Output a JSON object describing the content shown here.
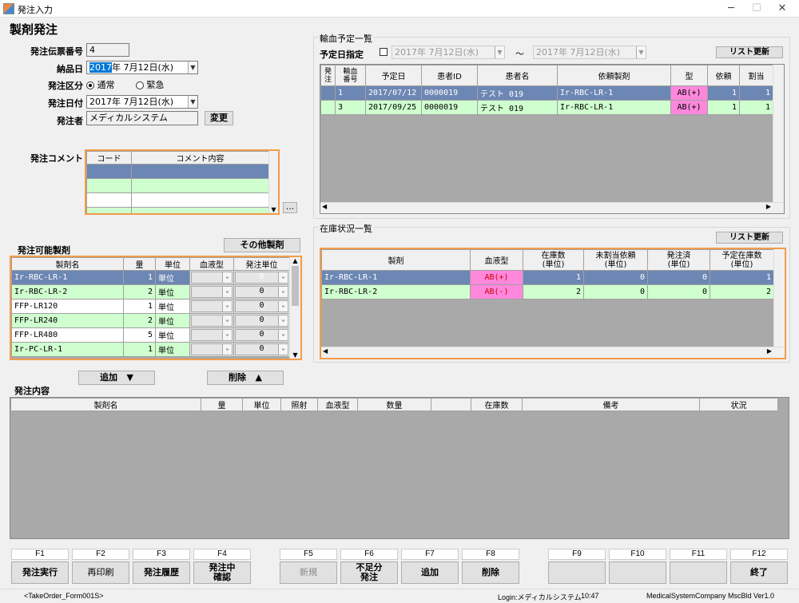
{
  "window": {
    "title": "発注入力"
  },
  "header": {
    "title": "製剤発注"
  },
  "form": {
    "slip_label": "発注伝票番号",
    "slip_value": "4",
    "delivery_label": "納品日",
    "delivery_year": "2017",
    "delivery_rest": "年  7月12日(水)",
    "kubun_label": "発注区分",
    "normal": "通常",
    "urgent": "緊急",
    "order_date_label": "発注日付",
    "order_date": "2017年  7月12日(水)",
    "orderer_label": "発注者",
    "orderer_value": "メディカルシステム",
    "change_btn": "変更",
    "comment_label": "発注コメント",
    "comment_col1": "コード",
    "comment_col2": "コメント内容",
    "more_btn": "..."
  },
  "transfusion": {
    "title": "輸血予定一覧",
    "date_label": "予定日指定",
    "date_from": "2017年  7月12日(水)",
    "tilde": "～",
    "date_to": "2017年  7月12日(水)",
    "refresh": "リスト更新",
    "columns": [
      "発注",
      "輸血番号",
      "予定日",
      "患者ID",
      "患者名",
      "依頼製剤",
      "型",
      "依頼",
      "割当"
    ],
    "col_order": "発注",
    "col_no_1": "輸血",
    "col_no_2": "番号",
    "rows": [
      {
        "no": "1",
        "date": "2017/07/12",
        "pid": "0000019",
        "name": "テスト  019",
        "product": "Ir-RBC-LR-1",
        "type": "AB(+)",
        "req": "1",
        "alloc": "1"
      },
      {
        "no": "3",
        "date": "2017/09/25",
        "pid": "0000019",
        "name": "テスト  019",
        "product": "Ir-RBC-LR-1",
        "type": "AB(+)",
        "req": "1",
        "alloc": "1"
      }
    ]
  },
  "available": {
    "title": "発注可能製剤",
    "other_btn": "その他製剤",
    "columns": [
      "製剤名",
      "量",
      "単位",
      "血液型",
      "発注単位"
    ],
    "rows": [
      {
        "name": "Ir-RBC-LR-1",
        "qty": "1",
        "unit": "単位",
        "sel": "0"
      },
      {
        "name": "Ir-RBC-LR-2",
        "qty": "2",
        "unit": "単位",
        "sel": "0"
      },
      {
        "name": "FFP-LR120",
        "qty": "1",
        "unit": "単位",
        "sel": "0"
      },
      {
        "name": "FFP-LR240",
        "qty": "2",
        "unit": "単位",
        "sel": "0"
      },
      {
        "name": "FFP-LR480",
        "qty": "5",
        "unit": "単位",
        "sel": "0"
      },
      {
        "name": "Ir-PC-LR-1",
        "qty": "1",
        "unit": "単位",
        "sel": "0"
      }
    ]
  },
  "stock": {
    "title": "在庫状況一覧",
    "refresh": "リスト更新",
    "col_product": "製剤",
    "col_blood": "血液型",
    "col_stock_1": "在庫数",
    "col_stock_2": "(単位)",
    "col_unalloc_1": "未割当依頼",
    "col_unalloc_2": "(単位)",
    "col_ordered_1": "発注済",
    "col_ordered_2": "(単位)",
    "col_planned_1": "予定在庫数",
    "col_planned_2": "(単位)",
    "rows": [
      {
        "product": "Ir-RBC-LR-1",
        "blood": "AB(+)",
        "stock": "1",
        "unalloc": "0",
        "ordered": "0",
        "planned": "1"
      },
      {
        "product": "Ir-RBC-LR-2",
        "blood": "AB(-)",
        "stock": "2",
        "unalloc": "0",
        "ordered": "0",
        "planned": "2"
      }
    ]
  },
  "actions": {
    "add": "追加",
    "add_icon": "▼",
    "delete": "削除",
    "delete_icon": "▲"
  },
  "order_content": {
    "title": "発注内容",
    "columns": [
      "製剤名",
      "量",
      "単位",
      "照射",
      "血液型",
      "数量",
      "",
      "在庫数",
      "備考",
      "状況"
    ]
  },
  "fkeys": [
    {
      "key": "F1",
      "label": "発注実行"
    },
    {
      "key": "F2",
      "label": "再印刷"
    },
    {
      "key": "F3",
      "label": "発注履歴"
    },
    {
      "key": "F4",
      "label": "発注中確認"
    },
    {
      "key": "F5",
      "label": "新規"
    },
    {
      "key": "F6",
      "label": "不足分発注"
    },
    {
      "key": "F7",
      "label": "追加"
    },
    {
      "key": "F8",
      "label": "削除"
    },
    {
      "key": "F9",
      "label": ""
    },
    {
      "key": "F10",
      "label": ""
    },
    {
      "key": "F11",
      "label": ""
    },
    {
      "key": "F12",
      "label": "終了"
    }
  ],
  "statusbar": {
    "form": "<TakeOrder_Form001S>",
    "login": "Login:メディカルシステム",
    "time": "10:47",
    "company": "MedicalSystemCompany  MscBld Ver1.0"
  },
  "colors": {
    "selected": "#6d87b4",
    "green": "#cfffcf",
    "pink": "#ff88dd",
    "orange": "#f29c4a"
  }
}
